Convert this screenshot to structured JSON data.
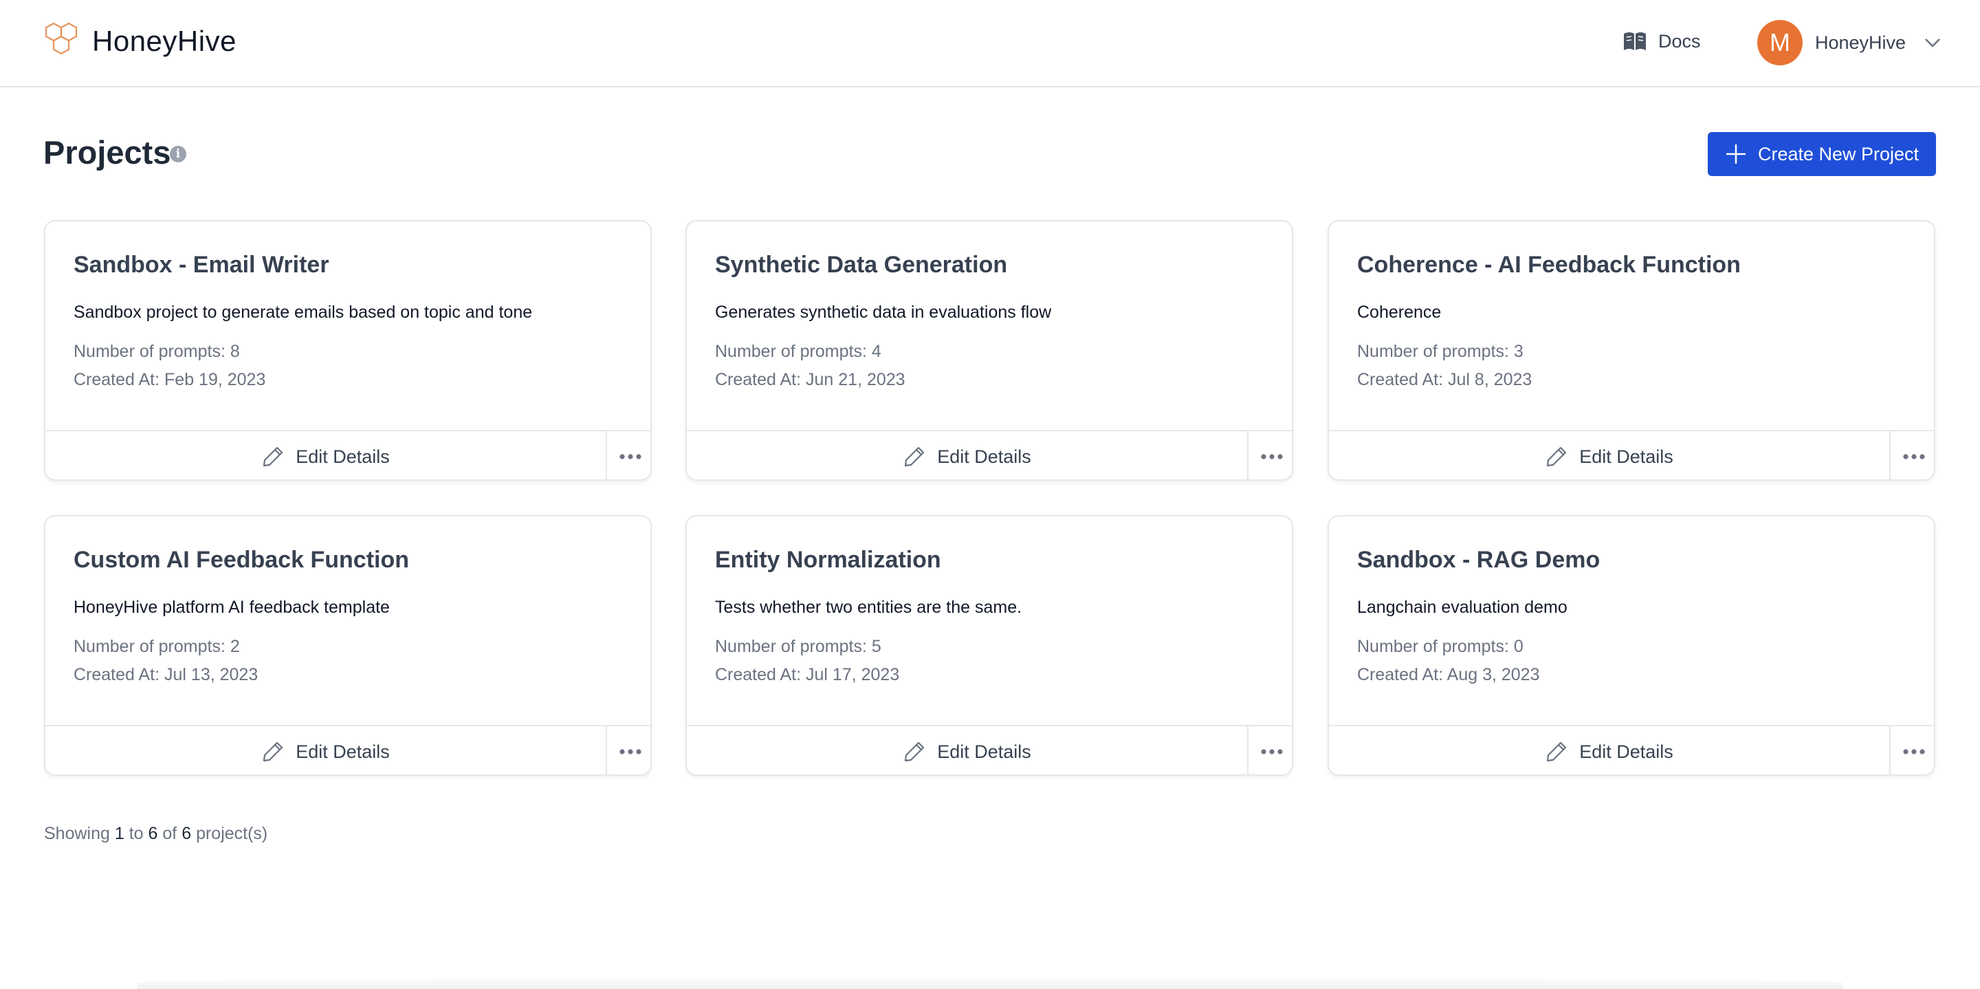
{
  "brand": {
    "name": "HoneyHive",
    "accent": "#e67333"
  },
  "nav": {
    "docs_label": "Docs",
    "user_initial": "M",
    "user_name": "HoneyHive"
  },
  "page": {
    "title": "Projects",
    "info_glyph": "i",
    "create_button_label": "Create New Project"
  },
  "colors": {
    "primary": "#1f4fd8",
    "border": "#e5e7eb",
    "muted_text": "#6b7280"
  },
  "projects": [
    {
      "title": "Sandbox - Email Writer",
      "description": "Sandbox project to generate emails based on topic and tone",
      "prompts": "Number of prompts: 8",
      "created": "Created At: Feb 19, 2023",
      "edit_label": "Edit Details"
    },
    {
      "title": "Synthetic Data Generation",
      "description": "Generates synthetic data in evaluations flow",
      "prompts": "Number of prompts: 4",
      "created": "Created At: Jun 21, 2023",
      "edit_label": "Edit Details"
    },
    {
      "title": "Coherence - AI Feedback Function",
      "description": "Coherence",
      "prompts": "Number of prompts: 3",
      "created": "Created At: Jul 8, 2023",
      "edit_label": "Edit Details"
    },
    {
      "title": "Custom AI Feedback Function",
      "description": "HoneyHive platform AI feedback template",
      "prompts": "Number of prompts: 2",
      "created": "Created At: Jul 13, 2023",
      "edit_label": "Edit Details"
    },
    {
      "title": "Entity Normalization",
      "description": "Tests whether two entities are the same.",
      "prompts": "Number of prompts: 5",
      "created": "Created At: Jul 17, 2023",
      "edit_label": "Edit Details"
    },
    {
      "title": "Sandbox - RAG Demo",
      "description": "Langchain evaluation demo",
      "prompts": "Number of prompts: 0",
      "created": "Created At: Aug 3, 2023",
      "edit_label": "Edit Details"
    }
  ],
  "pagination": {
    "prefix": "Showing",
    "from": "1",
    "to_word": "to",
    "to": "6",
    "of_word": "of",
    "total": "6",
    "suffix": "project(s)"
  }
}
